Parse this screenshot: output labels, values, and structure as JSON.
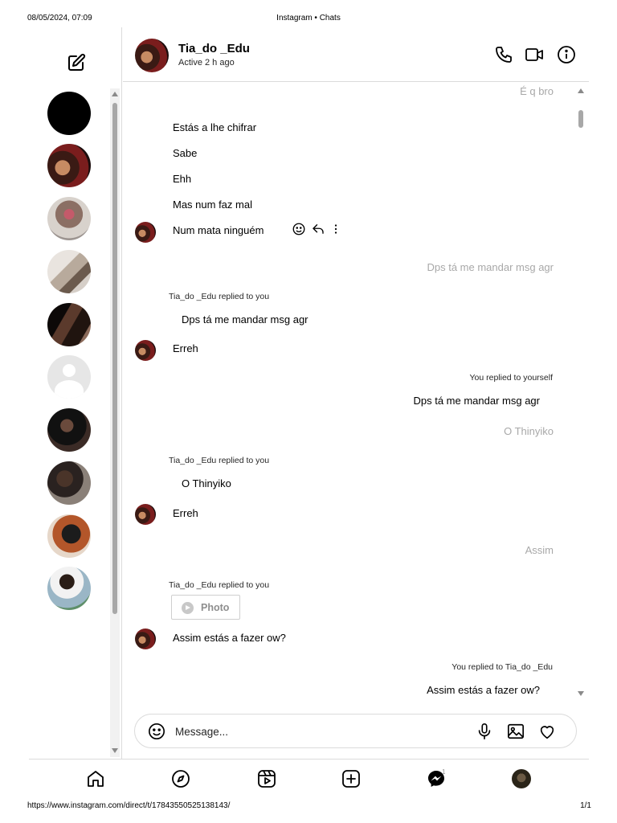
{
  "print_header": {
    "date": "08/05/2024, 07:09",
    "title": "Instagram • Chats"
  },
  "print_footer": {
    "url": "https://www.instagram.com/direct/t/17843550525138143/",
    "page": "1/1"
  },
  "chat": {
    "name": "Tia_do _Edu",
    "status": "Active 2 h ago"
  },
  "messages": {
    "m1": "É q bro",
    "m2": "Estás a lhe chifrar",
    "m3": "Sabe",
    "m4": "Ehh",
    "m5": "Mas num faz mal",
    "m6": "Num mata ninguém",
    "m7": "Dps tá me mandar msg agr",
    "r1_meta": "Tia_do _Edu replied to you",
    "r1_quote": "Dps tá me mandar msg agr",
    "m8": "Erreh",
    "r2_meta": "You replied to yourself",
    "r2_text": "Dps tá me mandar msg agr",
    "m9": "O Thinyiko",
    "r3_meta": "Tia_do _Edu replied to you",
    "r3_quote": "O Thinyiko",
    "m10": "Erreh",
    "m11": "Assim",
    "r4_meta": "Tia_do _Edu replied to you",
    "r4_photo_label": "Photo",
    "m12": "Assim estás a fazer ow?",
    "r5_meta": "You replied to Tia_do _Edu",
    "r5_text": "Assim estás a fazer ow?"
  },
  "composer": {
    "placeholder": "Message..."
  },
  "nav": {
    "notifications_badge": "1"
  },
  "colors": {
    "border": "#dbdbdb",
    "faded_text": "#a8a8a8",
    "text": "#000000"
  }
}
